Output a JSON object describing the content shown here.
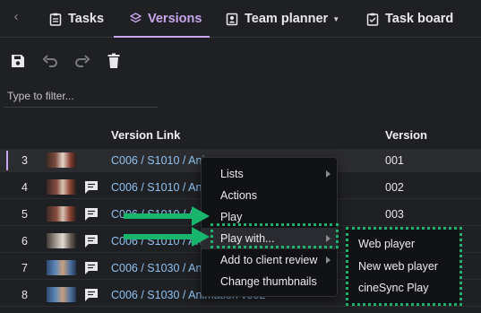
{
  "tabs": [
    {
      "label": "Tasks",
      "icon": "clipboard-icon",
      "active": false
    },
    {
      "label": "Versions",
      "icon": "layers-icon",
      "active": true
    },
    {
      "label": "Team planner",
      "icon": "person-badge-icon",
      "active": false
    },
    {
      "label": "Task board",
      "icon": "board-icon",
      "active": false
    }
  ],
  "toolbar": [
    "save-icon",
    "undo-icon",
    "redo-icon",
    "trash-icon"
  ],
  "filter": {
    "placeholder": "Type to filter...",
    "value": ""
  },
  "table": {
    "headers": {
      "link": "Version Link",
      "version": "Version"
    },
    "rows": [
      {
        "num": "3",
        "link": "C006 / S1010 / Ani",
        "version": "001",
        "notes": false,
        "selected": true
      },
      {
        "num": "4",
        "link": "C006 / S1010 / Ani",
        "version": "002",
        "notes": true,
        "selected": false
      },
      {
        "num": "5",
        "link": "C006 / S1010 / Ani",
        "version": "003",
        "notes": true,
        "selected": false
      },
      {
        "num": "6",
        "link": "C006 / S1010 / Ani",
        "version": "",
        "notes": true,
        "selected": false
      },
      {
        "num": "7",
        "link": "C006 / S1030 / Ani",
        "version": "",
        "notes": true,
        "selected": false
      },
      {
        "num": "8",
        "link": "C006 / S1030 / Animation v002",
        "version": "",
        "notes": true,
        "selected": false
      }
    ]
  },
  "context_menu": {
    "items": [
      {
        "label": "Lists",
        "submenu": true
      },
      {
        "label": "Actions",
        "submenu": false
      },
      {
        "label": "Play",
        "submenu": false
      },
      {
        "label": "Play with...",
        "submenu": true,
        "highlighted": true
      },
      {
        "label": "Add to client review",
        "submenu": true
      },
      {
        "label": "Change thumbnails",
        "submenu": false
      }
    ]
  },
  "play_with_submenu": {
    "items": [
      "Web player",
      "New web player",
      "cineSync Play"
    ]
  },
  "colors": {
    "accent": "#c8a5ec",
    "link": "#8fc2f2",
    "annotation": "#18b56c",
    "background": "#1f2023"
  }
}
